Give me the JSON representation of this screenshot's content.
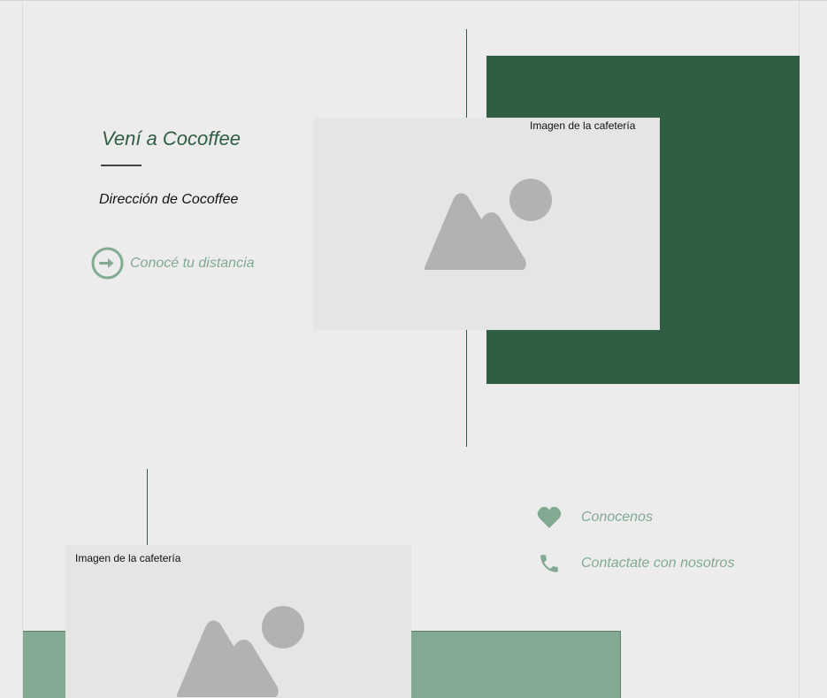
{
  "visit": {
    "title": "Vení a Cocoffee",
    "address": "Dirección de Cocoffee",
    "distance_link": "Conocé tu distancia"
  },
  "images": {
    "top_caption": "Imagen de la cafetería",
    "bottom_caption": "Imagen de la cafetería",
    "icon": "image-placeholder-icon"
  },
  "links": {
    "about": "Conocenos",
    "contact": "Contactate con nosotros"
  },
  "icons": {
    "distance": "arrow-circle-right-icon",
    "about": "heart-icon",
    "contact": "phone-icon"
  },
  "colors": {
    "background": "#ececec",
    "dark_green": "#2f5e43",
    "sage_green": "#82aa93",
    "placeholder_bg": "#e5e5e5",
    "placeholder_icon": "#b2b2b2"
  }
}
